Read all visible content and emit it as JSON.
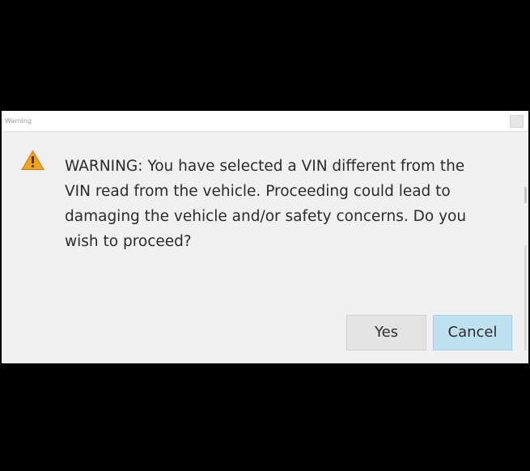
{
  "dialog": {
    "title": "Warning",
    "icon": "warning-triangle-icon",
    "message": "WARNING:  You have selected a VIN different from the\nVIN read from the vehicle.  Proceeding could lead to\ndamaging the vehicle and/or safety concerns.  Do you\nwish to proceed?",
    "buttons": {
      "yes_label": "Yes",
      "cancel_label": "Cancel"
    }
  },
  "colors": {
    "letterbox": "#000000",
    "dialog_background": "#f0f0f0",
    "icon_accent": "#f0a21e",
    "cancel_highlight": "#bfe0f1"
  }
}
